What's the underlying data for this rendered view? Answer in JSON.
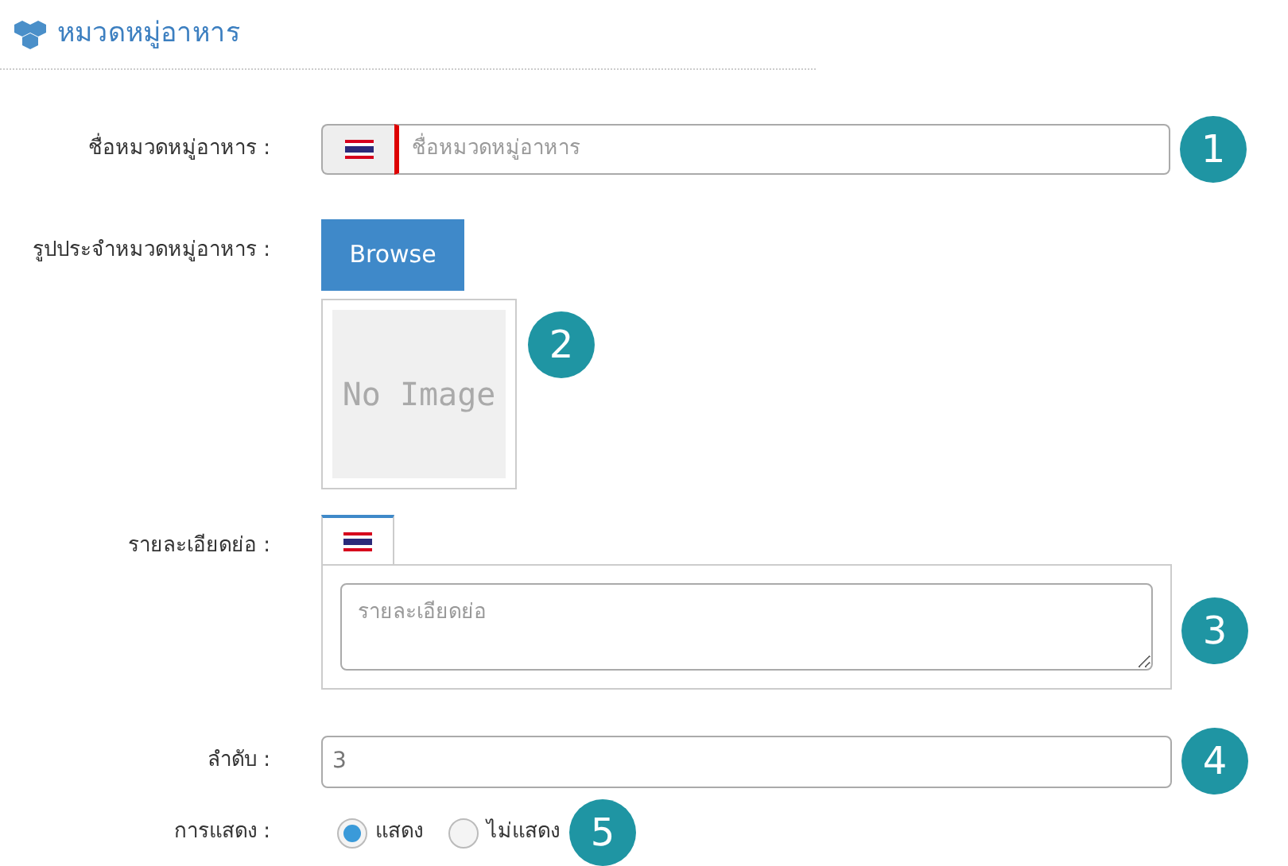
{
  "header": {
    "title": "หมวดหมู่อาหาร"
  },
  "name_field": {
    "label": "ชื่อหมวดหมู่อาหาร :",
    "placeholder": "ชื่อหมวดหมู่อาหาร",
    "badge": "1"
  },
  "image_field": {
    "label": "รูปประจำหมวดหมู่อาหาร :",
    "button": "Browse",
    "preview_text": "No Image",
    "badge": "2"
  },
  "description_field": {
    "label": "รายละเอียดย่อ :",
    "placeholder": "รายละเอียดย่อ",
    "badge": "3",
    "tabs": [
      {
        "selected": true
      }
    ]
  },
  "order_field": {
    "label": "ลำดับ :",
    "value": "3",
    "badge": "4"
  },
  "display_field": {
    "label": "การแสดง :",
    "badge": "5",
    "options": [
      {
        "label": "แสดง",
        "selected": true
      },
      {
        "label": "ไม่แสดง",
        "selected": false
      }
    ]
  }
}
